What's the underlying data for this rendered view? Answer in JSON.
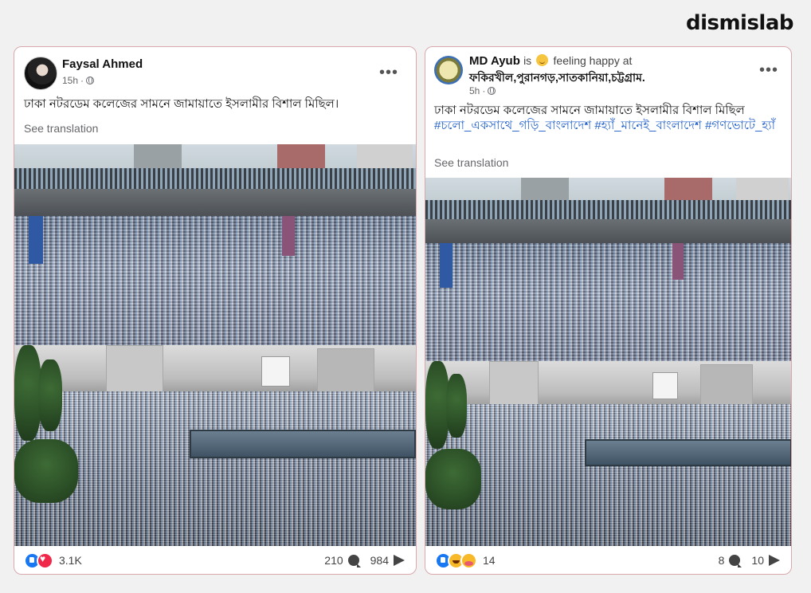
{
  "brand": "dismislab",
  "posts": [
    {
      "author": "Faysal Ahmed",
      "time": "15h",
      "text": "ঢাকা নটরডেম কলেজের সামনে জামায়াতে ইসলামীর বিশাল মিছিল।",
      "translate": "See translation",
      "reaction_count": "3.1K",
      "comments": "210",
      "shares": "984",
      "reactions": [
        "like-icon",
        "love-icon"
      ]
    },
    {
      "author": "MD Ayub",
      "status_prefix": "is",
      "status": "feeling happy at",
      "location": "ফকিরখীল,পুরানগড়,সাতকানিয়া,চট্টগ্রাম.",
      "time": "5h",
      "text": "ঢাকা নটরডেম কলেজের সামনে জামায়াতে ইসলামীর বিশাল মিছিল",
      "hashtags": "#চলো_একসাথে_গড়ি_বাংলাদেশ #হ্যাঁ_মানেই_বাংলাদেশ #গণভোটে_হ্যাঁ",
      "translate": "See translation",
      "reaction_count": "14",
      "comments": "8",
      "shares": "10",
      "reactions": [
        "like-icon",
        "haha-icon",
        "care-icon"
      ]
    }
  ],
  "more_label": "•••",
  "colors": {
    "background": "#f1f1f1",
    "card_border": "#d9a8ad",
    "hashtag": "#2563c9",
    "like": "#1877f2",
    "love": "#f02849"
  }
}
